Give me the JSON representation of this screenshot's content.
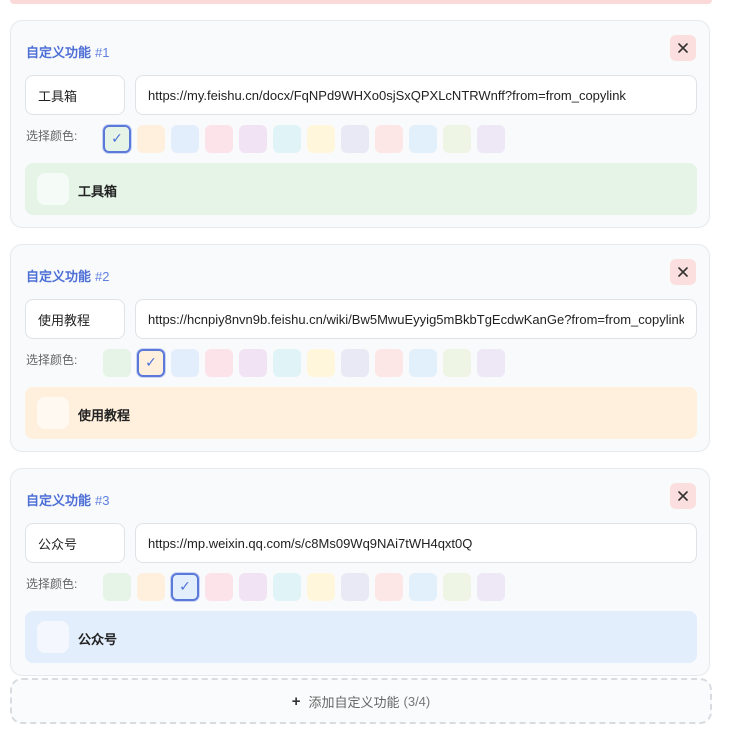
{
  "colors": {
    "swatches": [
      "#e6f4e8",
      "#fff0de",
      "#e3eefc",
      "#fce3ea",
      "#f2e3f4",
      "#e0f4f8",
      "#fff6dc",
      "#e9e9f5",
      "#fce6e6",
      "#e2f0fb",
      "#eef5e4",
      "#ede7f6"
    ]
  },
  "color_label": "选择颜色:",
  "cards": [
    {
      "title": "自定义功能",
      "index": "#1",
      "name": "工具箱",
      "url": "https://my.feishu.cn/docx/FqNPd9WHXo0sjSxQPXLcNTRWnff?from=from_copylink",
      "selected": 0,
      "preview_label": "工具箱"
    },
    {
      "title": "自定义功能",
      "index": "#2",
      "name": "使用教程",
      "url": "https://hcnpiy8nvn9b.feishu.cn/wiki/Bw5MwuEyyig5mBkbTgEcdwKanGe?from=from_copylink",
      "selected": 1,
      "preview_label": "使用教程"
    },
    {
      "title": "自定义功能",
      "index": "#3",
      "name": "公众号",
      "url": "https://mp.weixin.qq.com/s/c8Ms09Wq9NAi7tWH4qxt0Q",
      "selected": 2,
      "preview_label": "公众号"
    }
  ],
  "checkmark": "✓",
  "add_button": {
    "icon": "+",
    "label": "添加自定义功能",
    "count": "(3/4)"
  }
}
